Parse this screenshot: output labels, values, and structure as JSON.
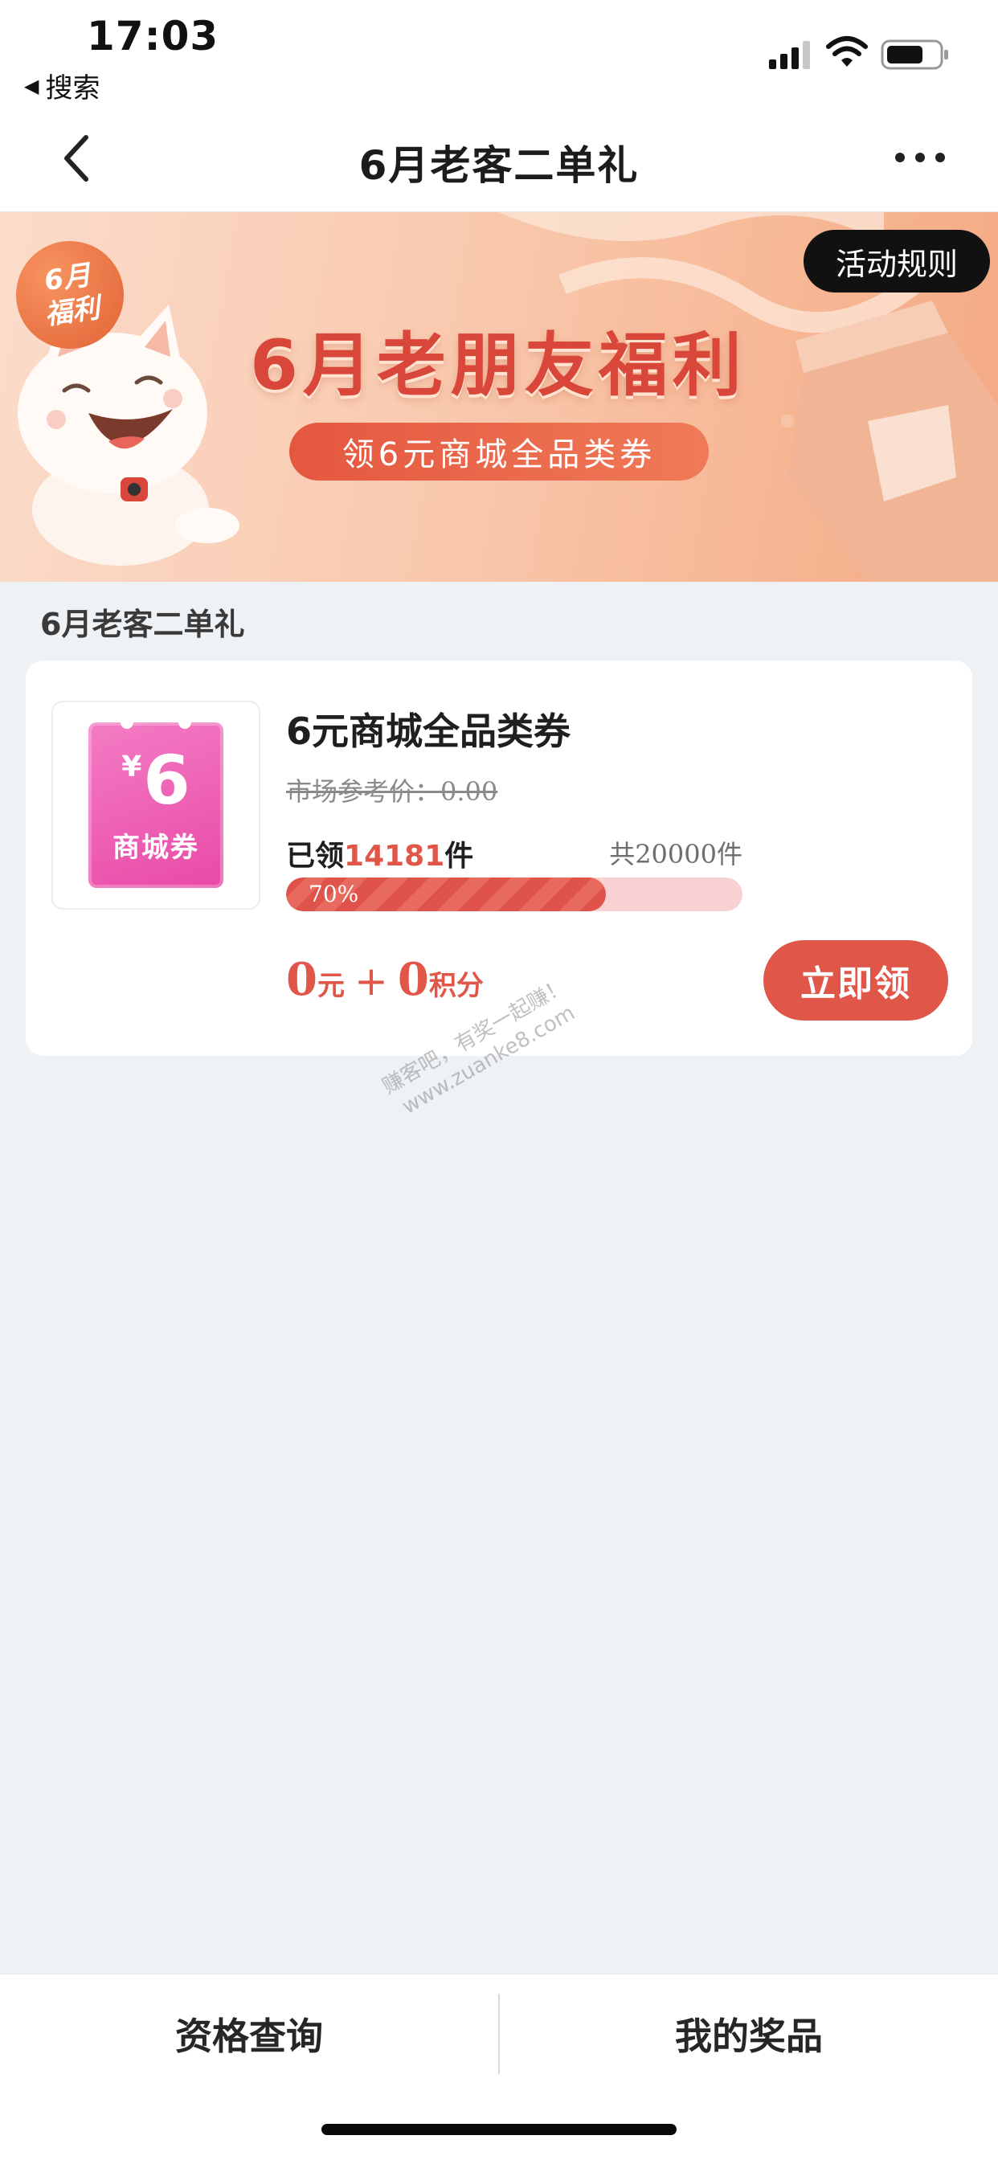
{
  "status_bar": {
    "time": "17:03",
    "back_app_label": "搜索",
    "icons": [
      "cellular-signal-icon",
      "wifi-icon",
      "battery-icon"
    ]
  },
  "nav": {
    "title": "6月老客二单礼",
    "icons": [
      "chevron-left-icon",
      "more-dots-icon"
    ]
  },
  "banner": {
    "badge_line1": "6月",
    "badge_line2": "福利",
    "title": "6月老朋友福利",
    "subtitle": "领6元商城全品类券",
    "rules_button": "活动规则"
  },
  "section": {
    "title": "6月老客二单礼"
  },
  "product": {
    "coupon_currency": "¥",
    "coupon_value": "6",
    "coupon_label": "商城券",
    "name": "6元商城全品类券",
    "market_price": "市场参考价：0.00",
    "claimed_prefix": "已领",
    "claimed_count": "14181",
    "claimed_suffix": "件",
    "total": "共20000件",
    "progress_label": "70%",
    "progress_value": 0.7,
    "price_cash": "0",
    "price_cash_unit": "元",
    "price_plus": "+",
    "price_points": "0",
    "price_points_unit": "积分",
    "claim_button": "立即领"
  },
  "watermark": {
    "line1": "赚客吧，有奖一起赚！",
    "line2": "www.zuanke8.com"
  },
  "bottom_bar": {
    "left_tab": "资格查询",
    "right_tab": "我的奖品"
  },
  "colors": {
    "accent": "#e0574a",
    "page_background": "#eff2f5",
    "coupon_pink": "#e94aa7",
    "rules_button_bg": "#111111"
  }
}
